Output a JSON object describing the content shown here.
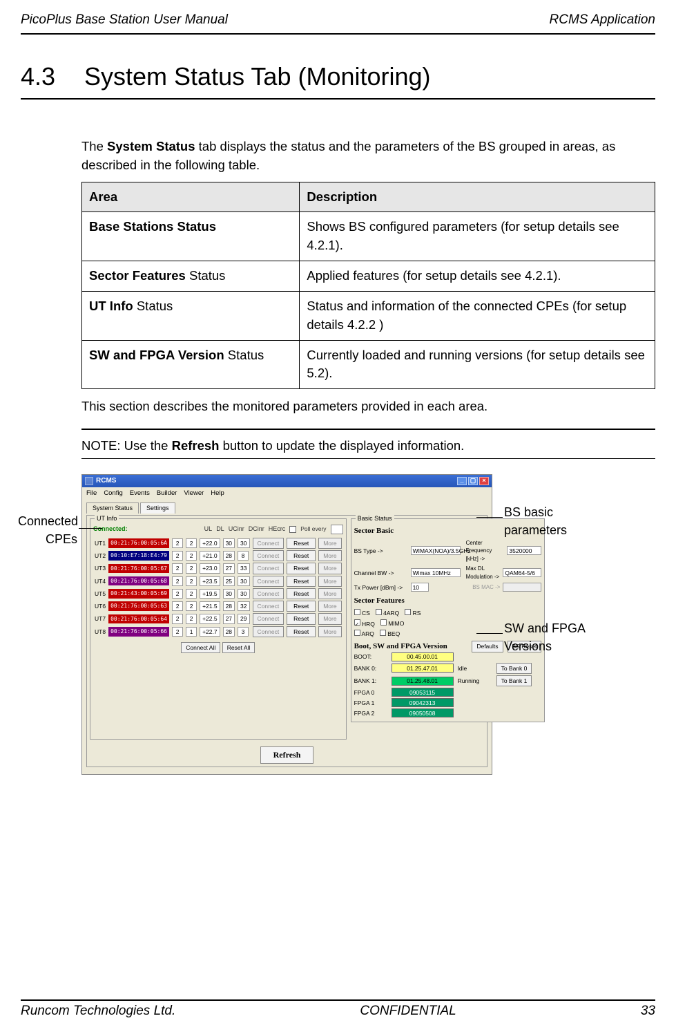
{
  "header": {
    "left": "PicoPlus Base Station User Manual",
    "right": "RCMS Application"
  },
  "section": {
    "number": "4.3",
    "title": "System Status Tab (Monitoring)"
  },
  "intro": {
    "before_strong": "The ",
    "strong": "System Status",
    "after_strong": " tab displays the status and the parameters of the BS grouped in areas, as described in the following table."
  },
  "table": {
    "head_area": "Area",
    "head_desc": "Description",
    "rows": [
      {
        "area_strong": "Base Stations Status",
        "area_rest": "",
        "desc": "Shows BS configured parameters (for setup details see 4.2.1)."
      },
      {
        "area_strong": "Sector Features",
        "area_rest": " Status",
        "desc": "Applied features (for setup details see 4.2.1)."
      },
      {
        "area_strong": "UT Info",
        "area_rest": " Status",
        "desc": "Status and information of the connected CPEs (for setup details 4.2.2 )"
      },
      {
        "area_strong": "SW and FPGA Version",
        "area_rest": " Status",
        "desc": "Currently loaded and running versions (for setup details see 5.2)."
      }
    ]
  },
  "after_table_text": "This section describes the monitored parameters provided in each area.",
  "note": {
    "prefix": "NOTE: Use the ",
    "strong": "Refresh",
    "suffix": " button to update the displayed information."
  },
  "callouts": {
    "connected_cpes_l1": "Connected",
    "connected_cpes_l2": "CPEs",
    "bs_basic_l1": "BS basic",
    "bs_basic_l2": "parameters",
    "swfpga_l1": "SW and FPGA",
    "swfpga_l2": "Versions"
  },
  "app": {
    "title": "RCMS",
    "menus": [
      "File",
      "Config",
      "Events",
      "Builder",
      "Viewer",
      "Help"
    ],
    "tab_status": "System Status",
    "tab_settings": "Settings",
    "ut_group_label": "UT Info",
    "ut_connected": "Connected:",
    "ut_cols": {
      "ul": "UL",
      "dl": "DL",
      "ucinr": "UCinr",
      "dcinr": "DCinr",
      "hecrc": "HEcrc"
    },
    "ut_poll_label": "Poll every",
    "ut_btn_connect": "Connect",
    "ut_btn_reset": "Reset",
    "ut_btn_more": "More",
    "ut_btn_connect_all": "Connect All",
    "ut_btn_reset_all": "Reset All",
    "ut_rows": [
      {
        "id": "UT1",
        "mac": "00:21:76:00:05:6A",
        "mac_cls": "mac-red",
        "ul": "2",
        "dl": "2",
        "ucinr": "+22.0",
        "dcinr": "30",
        "hecrc": "30"
      },
      {
        "id": "UT2",
        "mac": "00:10:E7:18:E4:79",
        "mac_cls": "mac-blue",
        "ul": "2",
        "dl": "2",
        "ucinr": "+21.0",
        "dcinr": "28",
        "hecrc": "8"
      },
      {
        "id": "UT3",
        "mac": "00:21:76:00:05:67",
        "mac_cls": "mac-red",
        "ul": "2",
        "dl": "2",
        "ucinr": "+23.0",
        "dcinr": "27",
        "hecrc": "33"
      },
      {
        "id": "UT4",
        "mac": "00:21:76:00:05:68",
        "mac_cls": "mac-purple",
        "ul": "2",
        "dl": "2",
        "ucinr": "+23.5",
        "dcinr": "25",
        "hecrc": "30"
      },
      {
        "id": "UT5",
        "mac": "00:21:43:00:05:69",
        "mac_cls": "mac-red",
        "ul": "2",
        "dl": "2",
        "ucinr": "+19.5",
        "dcinr": "30",
        "hecrc": "30"
      },
      {
        "id": "UT6",
        "mac": "00:21:76:00:05:63",
        "mac_cls": "mac-red",
        "ul": "2",
        "dl": "2",
        "ucinr": "+21.5",
        "dcinr": "28",
        "hecrc": "32"
      },
      {
        "id": "UT7",
        "mac": "00:21:76:00:05:64",
        "mac_cls": "mac-red",
        "ul": "2",
        "dl": "2",
        "ucinr": "+22.5",
        "dcinr": "27",
        "hecrc": "29"
      },
      {
        "id": "UT8",
        "mac": "00:21:76:00:05:66",
        "mac_cls": "mac-purple",
        "ul": "2",
        "dl": "1",
        "ucinr": "+22.7",
        "dcinr": "28",
        "hecrc": "3"
      }
    ],
    "bs_group_label": "Basic Status",
    "sector_basic_title": "Sector Basic",
    "bs_type_lbl": "BS Type ->",
    "bs_type_val": "WIMAX(NOA)/3.5GHz",
    "center_freq_lbl": "Center Frequency [kHz] ->",
    "center_freq_val": "3520000",
    "ch_bw_lbl": "Channel BW ->",
    "ch_bw_val": "Wimax 10MHz",
    "max_dl_lbl": "Max DL Modulation ->",
    "max_dl_val": "QAM64-5/6",
    "tx_power_lbl": "Tx Power [dBm] ->",
    "tx_power_val": "10",
    "bs_mac_lbl": "BS MAC ->",
    "sector_features_title": "Sector Features",
    "feat_row1": [
      "CS",
      "4ARQ",
      "RS"
    ],
    "feat_row2": [
      "HRQ",
      "MIMO"
    ],
    "feat_row3": [
      "ARQ",
      "BEQ"
    ],
    "boot_title": "Boot, SW and FPGA Version",
    "boot_btn_defaults": "Defaults",
    "boot_btn_bsreset": "BS Reset",
    "boot_rows": [
      {
        "lbl": "BOOT:",
        "pill_cls": "pill-yellow",
        "val": "00.45.00.01",
        "stat": "",
        "btn": ""
      },
      {
        "lbl": "BANK 0:",
        "pill_cls": "pill-yellow",
        "val": "01.25.47.01",
        "stat": "Idle",
        "btn": "To Bank 0"
      },
      {
        "lbl": "BANK 1:",
        "pill_cls": "pill-green",
        "val": "01.25.48.01",
        "stat": "Running",
        "btn": "To Bank 1"
      },
      {
        "lbl": "FPGA 0",
        "pill_cls": "pill-green2",
        "val": "09053115",
        "stat": "",
        "btn": ""
      },
      {
        "lbl": "FPGA 1",
        "pill_cls": "pill-green2",
        "val": "09042313",
        "stat": "",
        "btn": ""
      },
      {
        "lbl": "FPGA 2",
        "pill_cls": "pill-green2",
        "val": "09050508",
        "stat": "",
        "btn": ""
      }
    ],
    "refresh": "Refresh"
  },
  "footer": {
    "left": "Runcom Technologies Ltd.",
    "center": "CONFIDENTIAL",
    "right": "33"
  }
}
